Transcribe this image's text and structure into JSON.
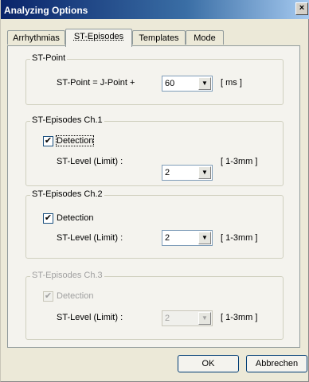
{
  "window": {
    "title": "Analyzing Options",
    "close_glyph": "×"
  },
  "tabs": [
    {
      "label": "Arrhythmias"
    },
    {
      "label": "ST-Episodes"
    },
    {
      "label": "Templates"
    },
    {
      "label": "Mode"
    }
  ],
  "st_point": {
    "title": "ST-Point",
    "label": "ST-Point = J-Point +",
    "value": "60",
    "unit": "[ ms ]"
  },
  "ch1": {
    "title": "ST-Episodes Ch.1",
    "detection_label": "Detection",
    "detection_checked": true,
    "level_label": "ST-Level (Limit) :",
    "value": "2",
    "unit": "[ 1-3mm ]"
  },
  "ch2": {
    "title": "ST-Episodes Ch.2",
    "detection_label": "Detection",
    "detection_checked": true,
    "level_label": "ST-Level (Limit) :",
    "value": "2",
    "unit": "[ 1-3mm ]"
  },
  "ch3": {
    "title": "ST-Episodes Ch.3",
    "detection_label": "Detection",
    "detection_checked": true,
    "level_label": "ST-Level (Limit) :",
    "value": "2",
    "unit": "[ 1-3mm ]"
  },
  "buttons": {
    "ok": "OK",
    "cancel": "Abbrechen"
  },
  "icons": {
    "checkmark": "check-icon",
    "dropdown": "chevron-down-icon"
  },
  "glyphs": {
    "check": "✔",
    "dropdown": "▼"
  }
}
